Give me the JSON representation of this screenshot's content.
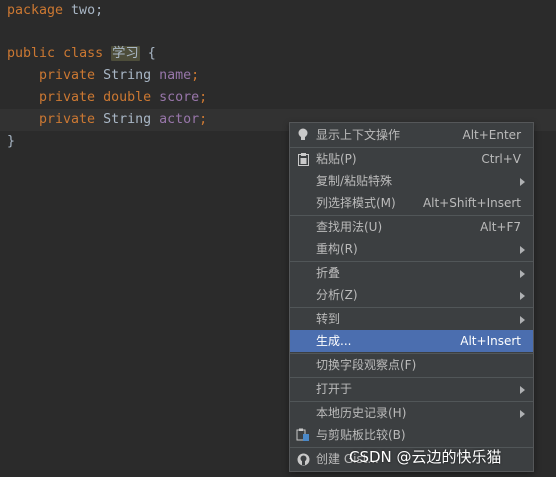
{
  "editor": {
    "line1": {
      "kw": "package",
      "rest": " two;"
    },
    "line3": {
      "kw1": "public",
      "kw2": "class",
      "class_name": "学习",
      "brace": "{"
    },
    "line4": {
      "kw": "private",
      "type": "String",
      "field": "name",
      "end": ";"
    },
    "line5": {
      "kw": "private",
      "type": "double",
      "field": "score",
      "end": ";"
    },
    "line6": {
      "kw": "private",
      "type": "String",
      "field": "actor",
      "end": ";"
    },
    "line7": {
      "brace": "}"
    }
  },
  "context_menu": {
    "items": [
      {
        "label": "显示上下文操作",
        "shortcut": "Alt+Enter",
        "icon": "lightbulb-icon"
      },
      {
        "label": "粘贴(P)",
        "shortcut": "Ctrl+V",
        "icon": "clipboard-icon"
      },
      {
        "label": "复制/粘贴特殊",
        "shortcut": "",
        "submenu": true
      },
      {
        "label": "列选择模式(M)",
        "shortcut": "Alt+Shift+Insert"
      },
      {
        "label": "查找用法(U)",
        "shortcut": "Alt+F7"
      },
      {
        "label": "重构(R)",
        "shortcut": "",
        "submenu": true
      },
      {
        "label": "折叠",
        "shortcut": "",
        "submenu": true
      },
      {
        "label": "分析(Z)",
        "shortcut": "",
        "submenu": true
      },
      {
        "label": "转到",
        "shortcut": "",
        "submenu": true
      },
      {
        "label": "生成...",
        "shortcut": "Alt+Insert",
        "selected": true
      },
      {
        "label": "切换字段观察点(F)",
        "shortcut": ""
      },
      {
        "label": "打开于",
        "shortcut": "",
        "submenu": true
      },
      {
        "label": "本地历史记录(H)",
        "shortcut": "",
        "submenu": true
      },
      {
        "label": "与剪贴板比较(B)",
        "shortcut": "",
        "icon": "compare-clipboard-icon"
      },
      {
        "label": "创建 Gist...",
        "shortcut": "",
        "icon": "github-icon"
      }
    ],
    "selected_color": "#4b6eaf"
  },
  "watermark": "CSDN @云边的快乐猫"
}
